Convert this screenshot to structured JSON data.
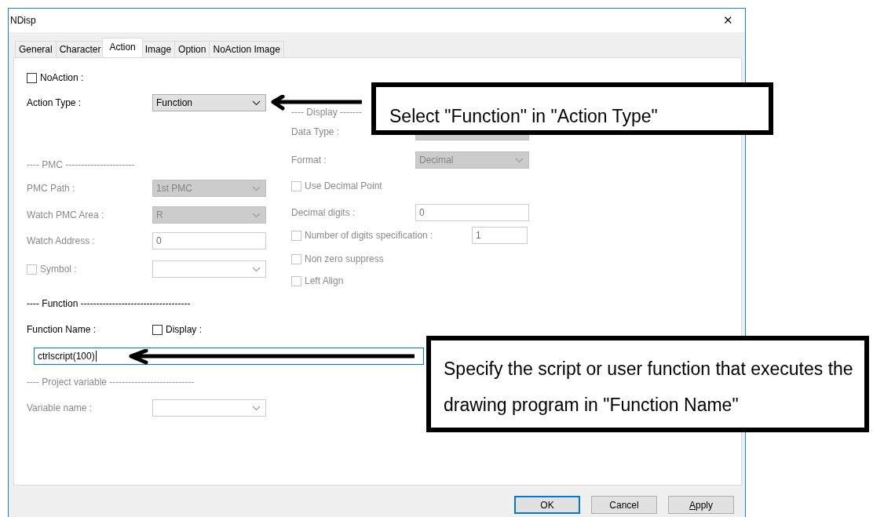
{
  "window": {
    "title": "NDisp",
    "close": "✕"
  },
  "tabs": [
    {
      "label": "General",
      "selected": false
    },
    {
      "label": "Character",
      "selected": false
    },
    {
      "label": "Action",
      "selected": true
    },
    {
      "label": "Image",
      "selected": false
    },
    {
      "label": "Option",
      "selected": false
    },
    {
      "label": "NoAction Image",
      "selected": false
    }
  ],
  "left_rows": [
    {
      "kind": "checkbox",
      "label": "NoAction :",
      "checked": false,
      "disabled": false
    },
    {
      "kind": "dropdown",
      "label": "Action Type :",
      "value": "Function",
      "disabled": false
    },
    {
      "kind": "header",
      "label": "---- PMC ----------------------",
      "disabled": true
    },
    {
      "kind": "dropdown",
      "label": "PMC Path :",
      "value": "1st PMC",
      "disabled": true
    },
    {
      "kind": "dropdown",
      "label": "Watch PMC Area :",
      "value": "R",
      "disabled": true
    },
    {
      "kind": "text",
      "label": "Watch Address :",
      "value": "0",
      "disabled": true
    },
    {
      "kind": "checkbox_combo",
      "label": "Symbol :",
      "checked": false,
      "disabled": true
    }
  ],
  "right_rows": [
    {
      "kind": "header",
      "label": "---- Display -------",
      "disabled": true
    },
    {
      "kind": "dropdown",
      "label": "Data Type :",
      "disabled": true
    },
    {
      "kind": "dropdown",
      "label": "Format :",
      "value": "Decimal",
      "disabled": true
    },
    {
      "kind": "checkbox",
      "label": "Use Decimal Point",
      "checked": false,
      "disabled": true
    },
    {
      "kind": "text",
      "label": "Decimal digits :",
      "value": "0",
      "disabled": true
    },
    {
      "kind": "checkbox_text",
      "label": "Number of digits specification :",
      "checked": false,
      "value": "1",
      "disabled": true
    },
    {
      "kind": "checkbox",
      "label": "Non zero suppress",
      "checked": false,
      "disabled": true
    },
    {
      "kind": "checkbox",
      "label": "Left Align",
      "checked": false,
      "disabled": true
    }
  ],
  "lower_rows": [
    {
      "kind": "header",
      "label": "---- Function -----------------------------------",
      "disabled": false
    },
    {
      "kind": "label_checkbox",
      "label": "Function Name :",
      "check_label": "Display :",
      "checked": false,
      "disabled": false
    },
    {
      "kind": "input",
      "value": "ctrlscript(100)",
      "focused": true,
      "disabled": false
    },
    {
      "kind": "header",
      "label": "---- Project variable ---------------------------",
      "disabled": true
    },
    {
      "kind": "combo",
      "label": "Variable name :",
      "disabled": true
    }
  ],
  "buttons": [
    {
      "label": "OK",
      "default": true,
      "mnemonic": false
    },
    {
      "label": "Cancel",
      "default": false,
      "mnemonic": false
    },
    {
      "label": "Apply",
      "default": false,
      "mnemonic": true
    }
  ],
  "callouts": [
    {
      "text": "Select \"Function\" in \"Action Type\""
    },
    {
      "text": "Specify the script or user function that executes the drawing program in \"Function Name\""
    }
  ]
}
